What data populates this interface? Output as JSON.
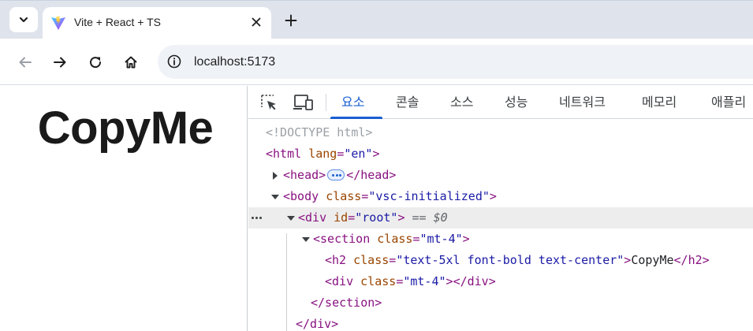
{
  "browser": {
    "tab": {
      "title": "Vite + React + TS",
      "favicon": "vite-logo-icon"
    },
    "address": {
      "url": "localhost:5173"
    },
    "icons": {
      "tab_search": "chevron-down-icon",
      "close": "close-icon",
      "new_tab": "plus-icon",
      "back": "back-arrow-icon",
      "forward": "forward-arrow-icon",
      "reload": "reload-icon",
      "home": "home-icon",
      "site_info": "info-icon"
    }
  },
  "page": {
    "heading": "CopyMe"
  },
  "devtools": {
    "tabs": [
      "요소",
      "콘솔",
      "소스",
      "성능",
      "네트워크",
      "메모리",
      "애플리"
    ],
    "active_tab": "요소",
    "accent": "#1a5fd0",
    "dom": {
      "doctype": "<!DOCTYPE html>",
      "html_open": "<html",
      "lang_attr": "lang",
      "lang_val": "\"en\"",
      "close_bracket": ">",
      "head_open": "<head>",
      "head_close": "</head>",
      "body_open": "<body",
      "class_attr": "class",
      "body_class_val": "\"vsc-initialized\"",
      "div_open": "<div",
      "id_attr": "id",
      "root_val": "\"root\"",
      "selected_marker": "== $0",
      "section_open": "<section",
      "section_class_val": "\"mt-4\"",
      "h2_open": "<h2",
      "h2_class_val": "\"text-5xl font-bold text-center\"",
      "h2_text": "CopyMe",
      "h2_close": "</h2>",
      "div2_class_val": "\"mt-4\"",
      "div_close": "</div>",
      "section_close": "</section>",
      "div_close_end": "</div>",
      "eq": "="
    }
  }
}
